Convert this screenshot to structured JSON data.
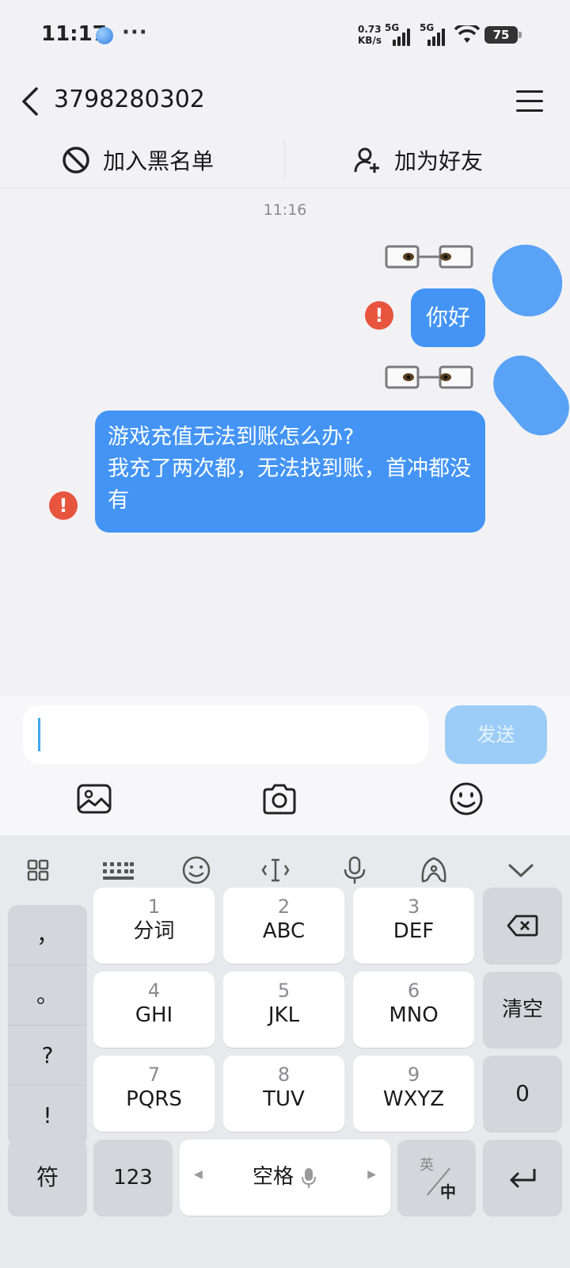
{
  "status_bar": {
    "time": "11:17",
    "more": "···",
    "net_speed_value": "0.73",
    "net_speed_unit": "KB/s",
    "sim1_type": "5G",
    "sim2_type": "5G",
    "battery": "75"
  },
  "header": {
    "title": "3798280302"
  },
  "actions": {
    "blacklist_label": "加入黑名单",
    "add_friend_label": "加为好友"
  },
  "chat": {
    "timestamp": "11:16",
    "messages": [
      {
        "text": "你好",
        "status": "failed"
      },
      {
        "text": "游戏充值无法到账怎么办?\n我充了两次都，无法找到账，首冲都没有",
        "status": "failed"
      }
    ],
    "alert_glyph": "!"
  },
  "composer": {
    "value": "",
    "send_label": "发送"
  },
  "keyboard": {
    "side_punct": [
      "，",
      "。",
      "?",
      "!"
    ],
    "keys": [
      {
        "num": "1",
        "label": "分词"
      },
      {
        "num": "2",
        "label": "ABC"
      },
      {
        "num": "3",
        "label": "DEF"
      },
      {
        "num": "4",
        "label": "GHI"
      },
      {
        "num": "5",
        "label": "JKL"
      },
      {
        "num": "6",
        "label": "MNO"
      },
      {
        "num": "7",
        "label": "PQRS"
      },
      {
        "num": "8",
        "label": "TUV"
      },
      {
        "num": "9",
        "label": "WXYZ"
      }
    ],
    "clear_label": "清空",
    "zero_label": "0",
    "symbol_label": "符",
    "numeric_label": "123",
    "space_label": "空格",
    "lang_top": "英",
    "lang_bottom": "中"
  },
  "colors": {
    "bubble": "#4394f5",
    "send_disabled": "#9ccdf7",
    "alert": "#e8553f",
    "avatar": "#5aa2f5"
  }
}
